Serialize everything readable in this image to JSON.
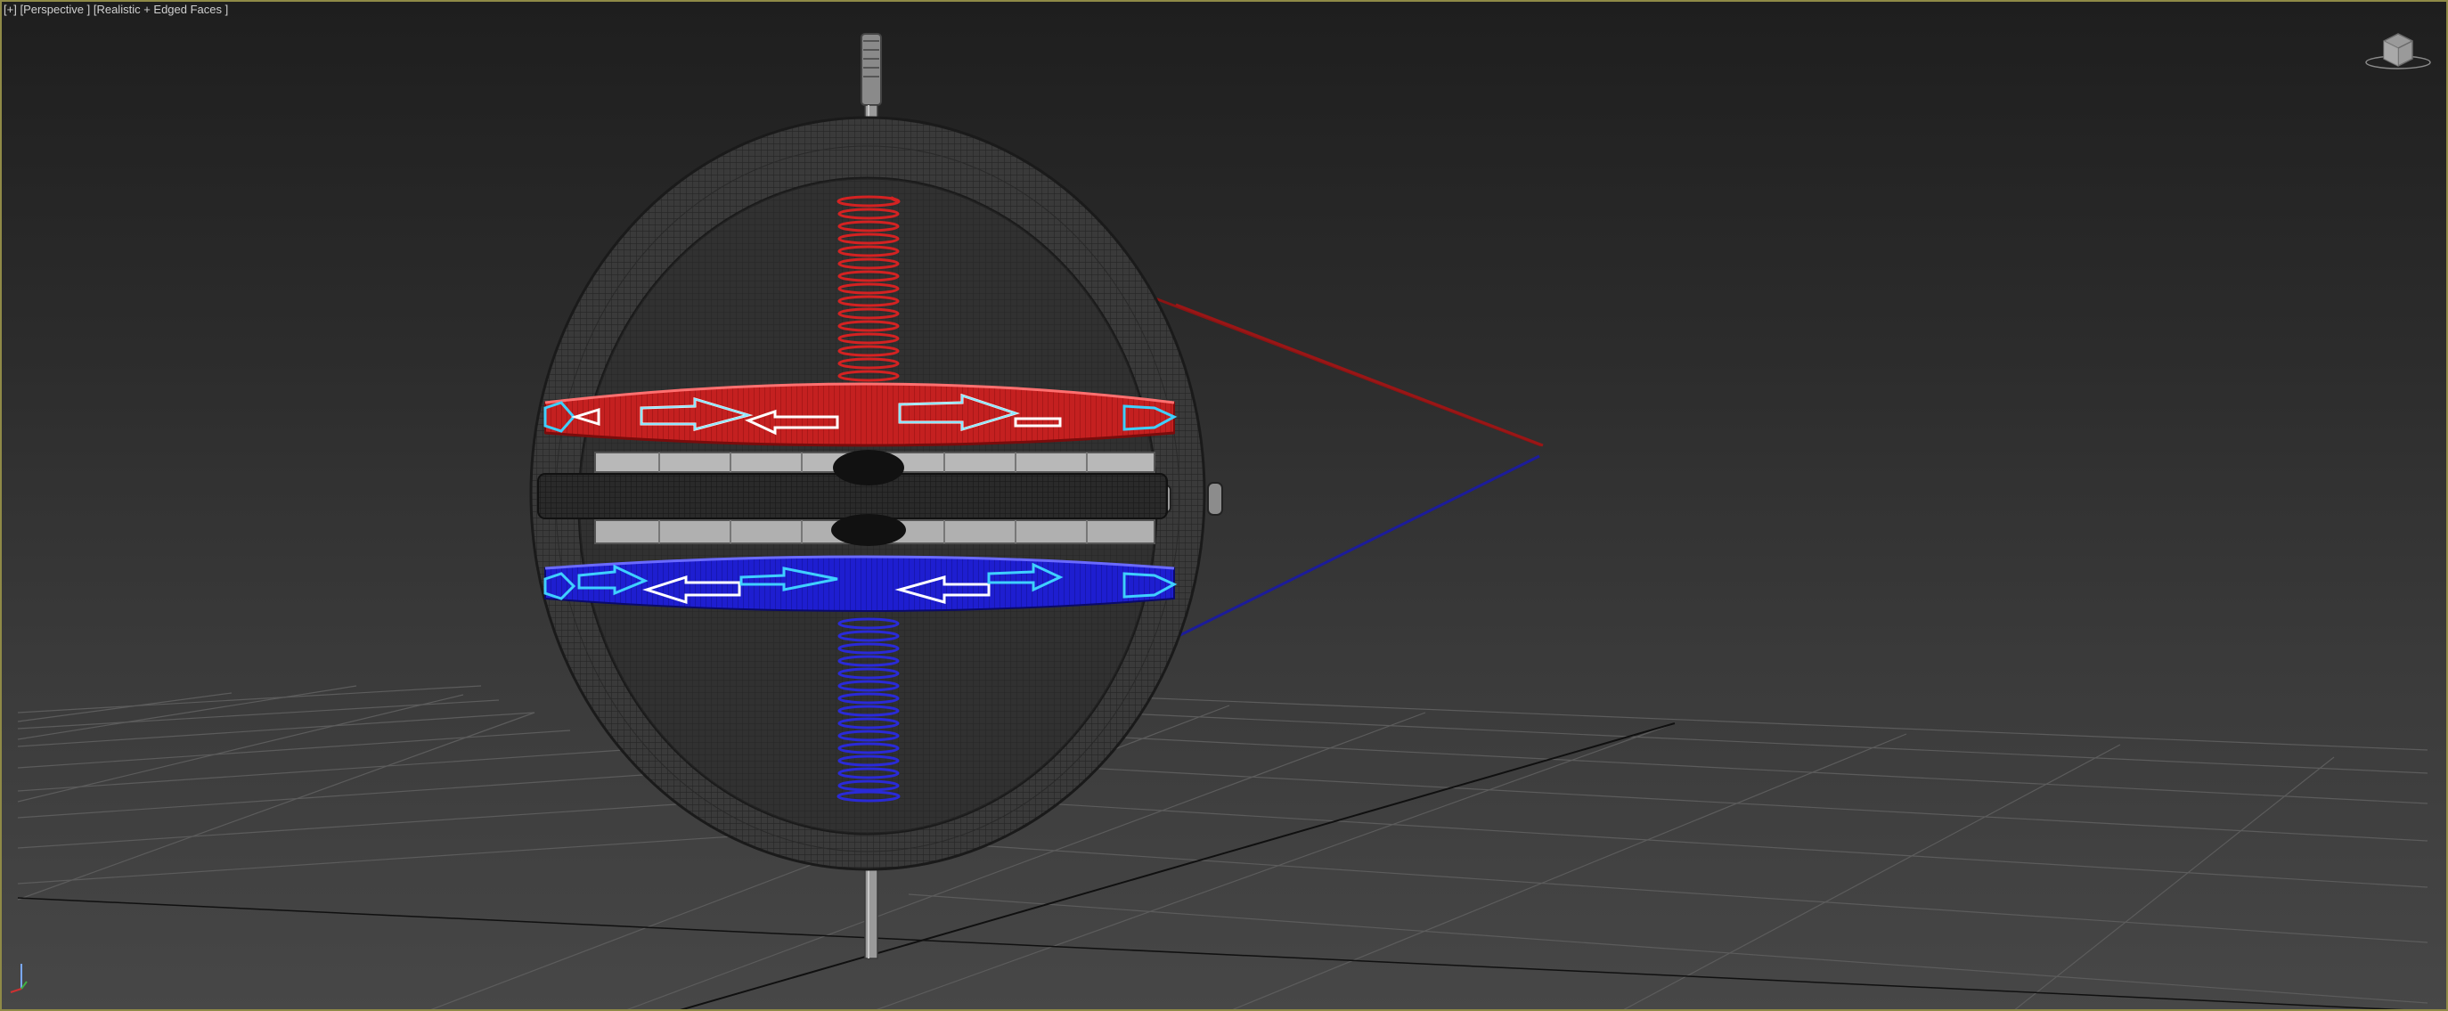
{
  "viewport": {
    "label_menu": "[+]",
    "label_view": "[Perspective ]",
    "label_shading": "[Realistic + Edged Faces ]"
  },
  "scene": {
    "objects": [
      "ground-grid",
      "gimbal-ring",
      "spindle",
      "rotor-disc",
      "red-ring",
      "blue-ring",
      "red-spring",
      "blue-spring"
    ],
    "colors": {
      "red_spring": "#d42222",
      "red_ring": "#c42020",
      "blue_spring": "#2a2ad8",
      "blue_ring": "#1e1ed0",
      "arrow_highlight": "#3fd0ff",
      "ring_metal": "#3c3c3c",
      "grid": "#5a5a5a",
      "viewport_border": "#8f8a47"
    }
  },
  "icons": {
    "viewcube": "viewcube-icon",
    "axis_tripod": "axis-tripod-icon"
  }
}
